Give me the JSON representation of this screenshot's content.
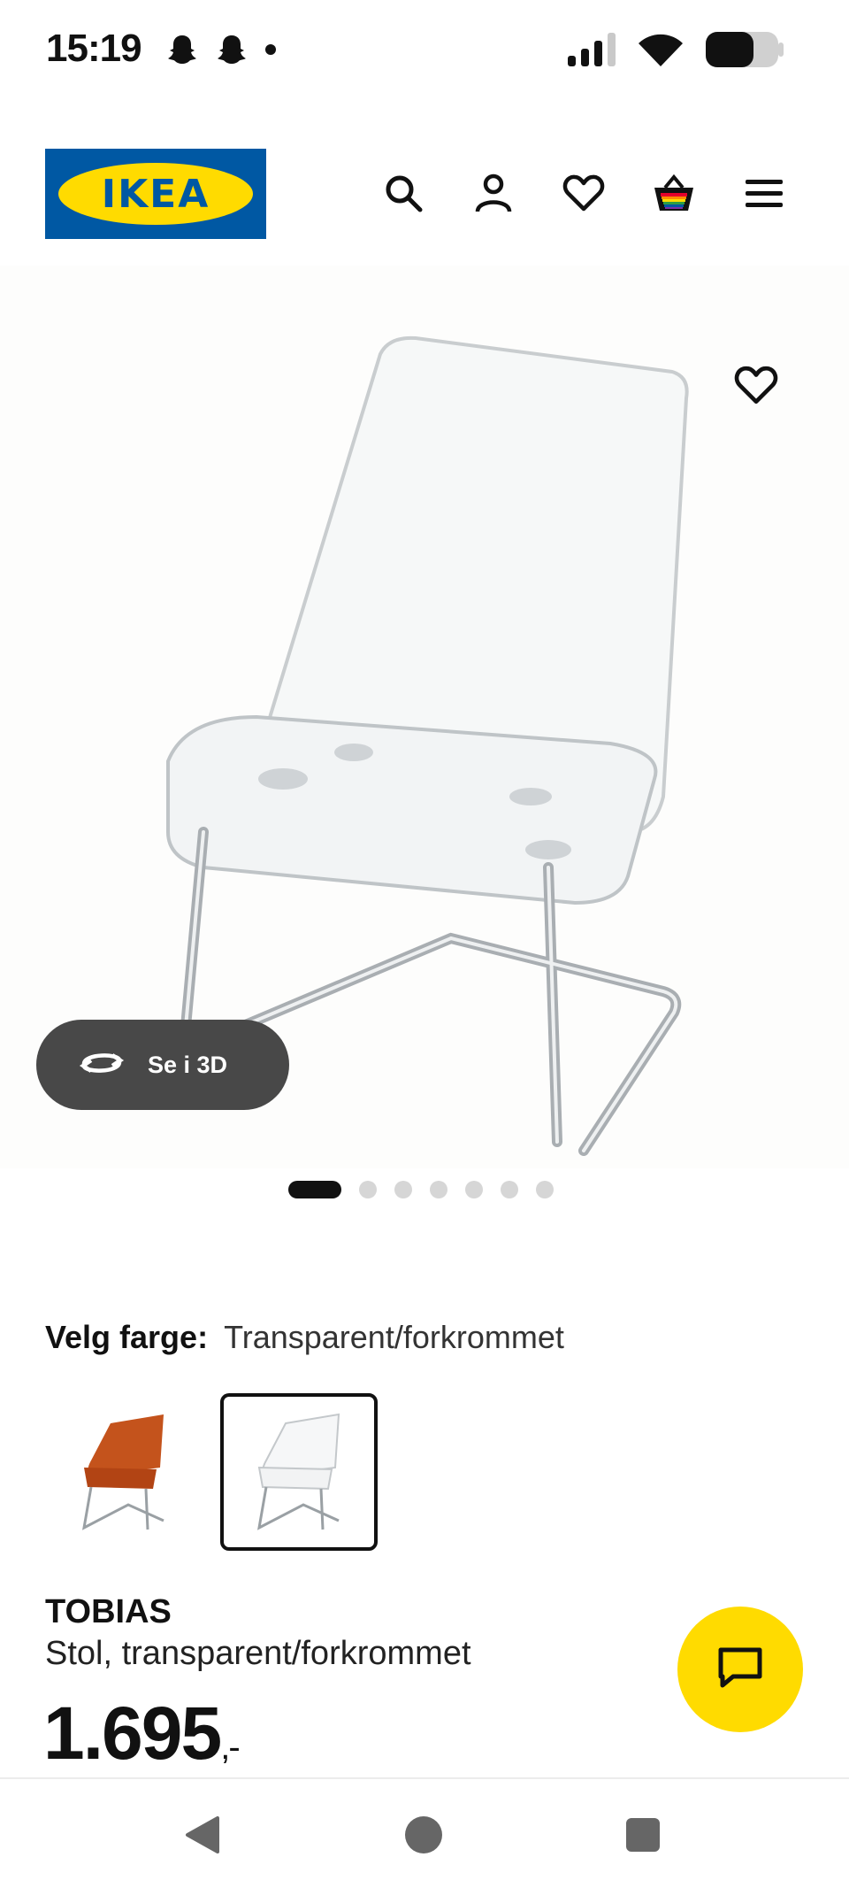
{
  "status_bar": {
    "time": "15:19",
    "left_icons": [
      "snapchat-icon",
      "snapchat-icon",
      "notification-dot-icon"
    ],
    "right_icons": [
      "signal-icon",
      "wifi-icon",
      "battery-icon"
    ]
  },
  "header": {
    "logo_text": "IKEA",
    "icons": [
      "search-icon",
      "account-icon",
      "favorites-icon",
      "shopping-bag-icon",
      "menu-icon"
    ]
  },
  "media": {
    "see_3d_label": "Se i 3D",
    "image_count": 7,
    "active_image": 1
  },
  "color": {
    "label": "Velg farge:",
    "value": "Transparent/forkrommet",
    "swatches": [
      {
        "name": "orange",
        "selected": false
      },
      {
        "name": "transparent",
        "selected": true
      }
    ]
  },
  "product": {
    "name": "TOBIAS",
    "description": "Stol, transparent/forkrommet",
    "price": "1.695",
    "price_suffix": ",-"
  },
  "colors": {
    "brand_blue": "#0058a3",
    "brand_yellow": "#ffdb00",
    "button_dark": "#484848"
  }
}
